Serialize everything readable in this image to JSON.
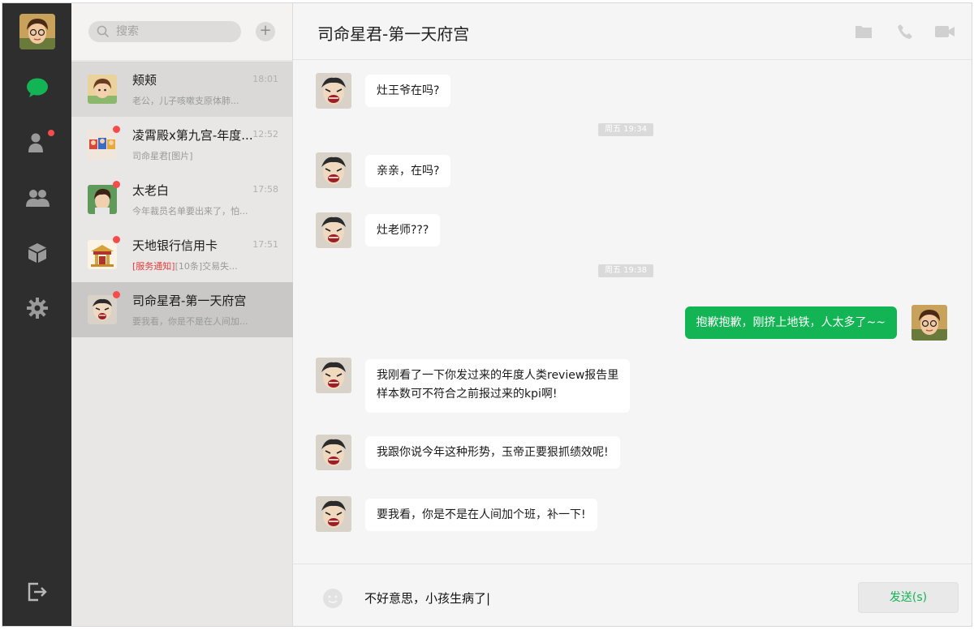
{
  "search": {
    "placeholder": "搜索"
  },
  "list_actions": {
    "add": "+"
  },
  "nav": {
    "items": [
      {
        "icon": "chat-icon",
        "active": true
      },
      {
        "icon": "contacts-icon",
        "badge": true
      },
      {
        "icon": "group-icon"
      },
      {
        "icon": "box-icon"
      },
      {
        "icon": "settings-icon"
      }
    ],
    "logout_icon": "logout-icon"
  },
  "conversations": [
    {
      "name": "颊颊",
      "time": "18:01",
      "preview_tag": "",
      "preview": "老公，儿子咳嗽支原体肺...",
      "unread": false
    },
    {
      "name": "凌霄殿x第九宫-年度...",
      "time": "12:52",
      "preview_tag": "",
      "preview": "司命星君[图片]",
      "unread": true
    },
    {
      "name": "太老白",
      "time": "17:58",
      "preview_tag": "",
      "preview": "今年裁员名单要出来了，怕...",
      "unread": true
    },
    {
      "name": "天地银行信用卡",
      "time": "17:51",
      "preview_tag": "[服务通知]",
      "preview": "[10条]交易失...",
      "unread": true
    },
    {
      "name": "司命星君-第一天府宫",
      "time": "",
      "preview_tag": "",
      "preview": "要我看，你是不是在人间加...",
      "unread": true
    }
  ],
  "chat": {
    "title": "司命星君-第一天府宫",
    "header_icons": [
      "folder-icon",
      "phone-icon",
      "video-icon"
    ],
    "messages": [
      {
        "type": "in",
        "text": "灶王爷在吗?"
      },
      {
        "type": "time",
        "text": "周五 19:34"
      },
      {
        "type": "in",
        "text": "亲亲，在吗?"
      },
      {
        "type": "in",
        "text": "灶老师???"
      },
      {
        "type": "time",
        "text": "周五 19:38"
      },
      {
        "type": "out",
        "text": "抱歉抱歉，刚挤上地铁，人太多了~~"
      },
      {
        "type": "in",
        "line1": "我刚看了一下你发过来的年度人类review报告里",
        "line2": "样本数可不符合之前报过来的kpi啊!"
      },
      {
        "type": "in",
        "text": "我跟你说今年这种形势，玉帝正要狠抓绩效呢!"
      },
      {
        "type": "in",
        "text": "要我看，你是不是在人间加个班，补一下!"
      }
    ]
  },
  "composer": {
    "value": "不好意思，小孩生病了|",
    "send_label": "发送(s)"
  },
  "colors": {
    "accent": "#12b453",
    "rail": "#2e2e2e",
    "badge": "#f74c4c"
  }
}
